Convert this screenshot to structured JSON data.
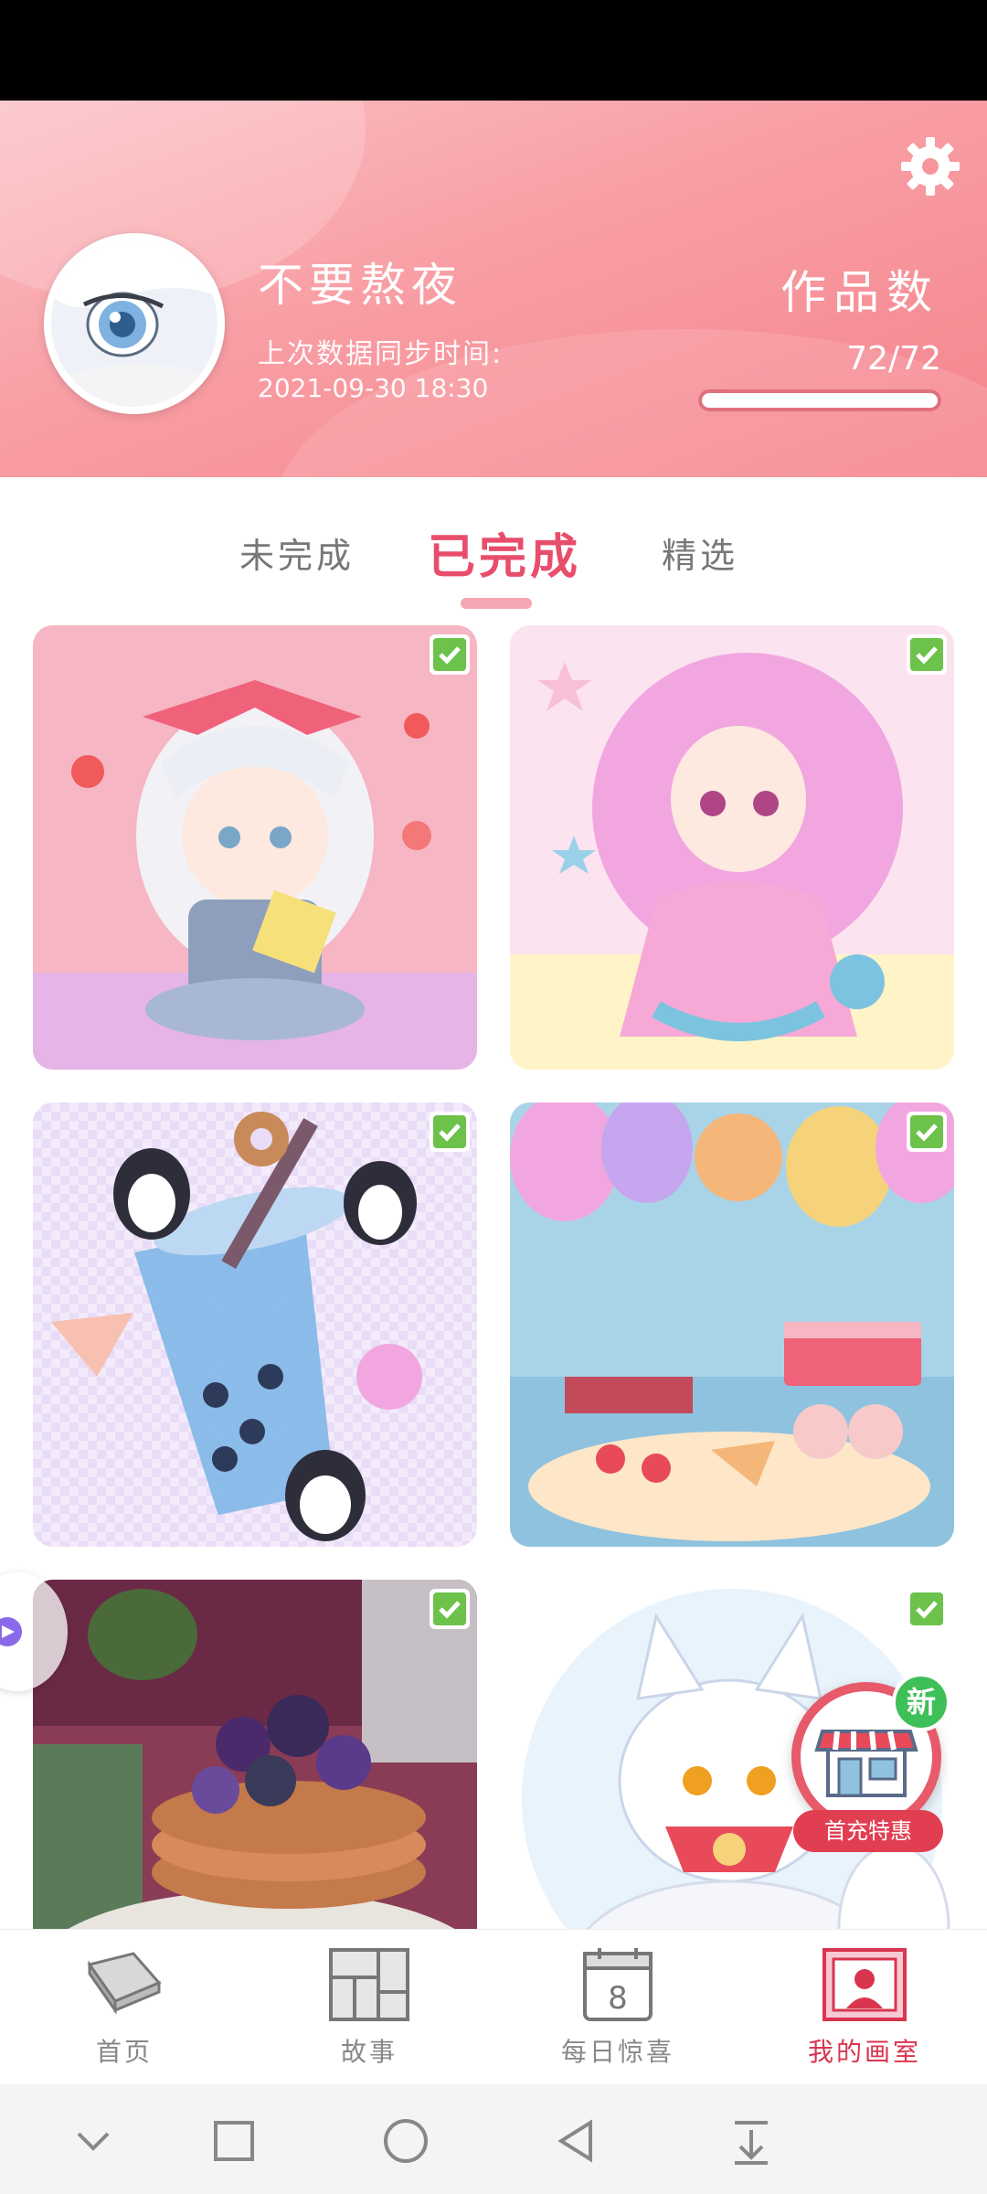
{
  "profile": {
    "username": "不要熬夜",
    "sync_label": "上次数据同步时间:",
    "sync_time": "2021-09-30 18:30",
    "works_label": "作品数",
    "works_count": "72/72",
    "works_progress": 1.0
  },
  "tabs": [
    {
      "label": "未完成",
      "active": false
    },
    {
      "label": "已完成",
      "active": true
    },
    {
      "label": "精选",
      "active": false
    }
  ],
  "gallery": [
    {
      "title": "",
      "completed": true
    },
    {
      "title": "",
      "completed": true
    },
    {
      "title": "",
      "completed": true
    },
    {
      "title": "",
      "completed": true
    },
    {
      "title": "",
      "completed": true
    },
    {
      "title": "",
      "completed": true
    }
  ],
  "promo": {
    "badge": "新",
    "label": "首充特惠"
  },
  "bottom_nav": [
    {
      "label": "首页",
      "icon": "book-icon",
      "active": false
    },
    {
      "label": "故事",
      "icon": "comic-panels-icon",
      "active": false
    },
    {
      "label": "每日惊喜",
      "icon": "calendar-icon",
      "active": false,
      "calendar_day": "8"
    },
    {
      "label": "我的画室",
      "icon": "portrait-frame-icon",
      "active": true
    }
  ],
  "colors": {
    "accent": "#e84d6c",
    "header_pink": "#f89ea4",
    "check_green": "#6cc24a"
  }
}
